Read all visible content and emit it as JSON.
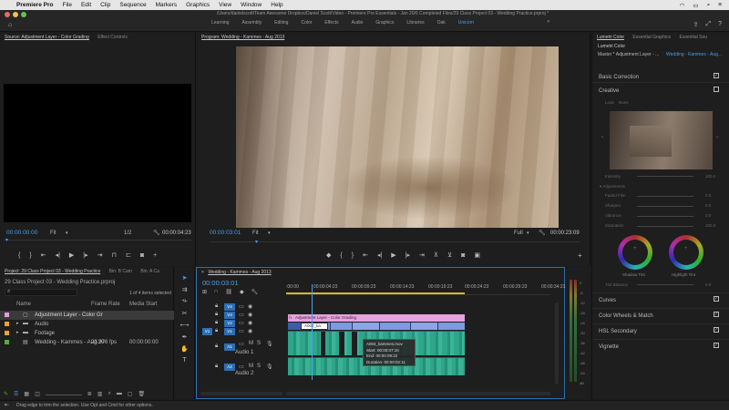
{
  "menubar": {
    "app": "Premiere Pro",
    "items": [
      "File",
      "Edit",
      "Clip",
      "Sequence",
      "Markers",
      "Graphics",
      "View",
      "Window",
      "Help"
    ]
  },
  "window": {
    "title": "/Users/danielscott/Team Awesome Dropbox/Daniel Scott/Video - Premiere Pro Essentials - Jan 20/6 Completed Files/29 Class Project 03 - Wedding Practice.prproj *"
  },
  "workspaces": [
    "Learning",
    "Assembly",
    "Editing",
    "Color",
    "Effects",
    "Audio",
    "Graphics",
    "Libraries",
    "Oak",
    "Unicorn"
  ],
  "active_workspace": "Unicorn",
  "source": {
    "tab": "Source: Adjustment Layer - Color Grading",
    "tab2": "Effect Controls",
    "timecode": "00:00:00:00",
    "fit": "Fit",
    "ratio": "1/2",
    "duration": "00:00:04:23"
  },
  "program": {
    "tab": "Program: Wedding - Kammes - Aug 2013",
    "timecode": "00:00:03:01",
    "fit": "Fit",
    "quality": "Full",
    "duration": "00:00:23:09"
  },
  "project": {
    "tab": "Project: 29 Class Project 03 - Wedding Practice",
    "tab2": "Bin: B Cam",
    "tab3": "Bin: A Ca",
    "file": "29 Class Project 03 - Wedding Practice.prproj",
    "count": "1 of 4 items selected",
    "columns": [
      "Name",
      "Frame Rate",
      "Media Start"
    ],
    "items": [
      {
        "name": "Adjustment Layer - Color Gr",
        "rate": "",
        "start": "",
        "color": "#e79be0"
      },
      {
        "name": "Audio",
        "rate": "",
        "start": "",
        "color": "#e8a23a"
      },
      {
        "name": "Footage",
        "rate": "",
        "start": "",
        "color": "#e8a23a"
      },
      {
        "name": "Wedding - Kammes - Aug 20",
        "rate": "23.976 fps",
        "start": "00:00:00:00",
        "color": "#4fb23e"
      }
    ]
  },
  "timeline": {
    "tab": "Wedding - Kammes - Aug 2013",
    "timecode": "00:00:03:01",
    "ruler": [
      ":00:00",
      "00:00:04:23",
      "00:00:09:23",
      "00:00:14:23",
      "00:00:19:23",
      "00:00:24:23",
      "00:00:29:23",
      "00:00:34:23"
    ],
    "tracks": [
      "V4",
      "V3",
      "V2",
      "V1",
      "A1",
      "A2"
    ],
    "adjustment_clip": "Adjustment Layer - Color Grading",
    "v1_clip": "A004_ka",
    "audio1_label": "Audio 1",
    "audio2_label": "Audio 2",
    "tooltip": [
      "A004_kammes.mov",
      "Start: 00:00:07:10",
      "End: 00:00:09:22",
      "Duration: 00:00:02:11"
    ]
  },
  "meters": [
    "0",
    "-6",
    "-12",
    "-18",
    "-24",
    "-30",
    "-36",
    "-42",
    "-48",
    "-54",
    "dB"
  ],
  "lumetri": {
    "tabs": [
      "Lumetri Color",
      "Essential Graphics",
      "Essential Sou"
    ],
    "panel_title": "Lumetri Color",
    "master": "Master * Adjustment Layer - ...",
    "target": "Wedding - Kammes - Aug...",
    "sections": [
      "Basic Correction",
      "Creative",
      "Curves",
      "Color Wheels & Match",
      "HSL Secondary",
      "Vignette"
    ],
    "look_label": "Look",
    "look_value": "None",
    "intensity_label": "Intensity",
    "intensity_value": "100.0",
    "adjustments": "Adjustments",
    "sliders": [
      {
        "label": "Faded Film",
        "value": "0.0"
      },
      {
        "label": "Sharpen",
        "value": "0.0"
      },
      {
        "label": "Vibrance",
        "value": "0.0"
      },
      {
        "label": "Saturation",
        "value": "100.0"
      }
    ],
    "shadow_tint": "Shadow Tint",
    "highlight_tint": "Highlight Tint",
    "tint_balance": "Tint Balance",
    "tint_balance_value": "0.0"
  },
  "statusbar": "Drag edge to trim the selection. Use Opt and Cmd for other options."
}
